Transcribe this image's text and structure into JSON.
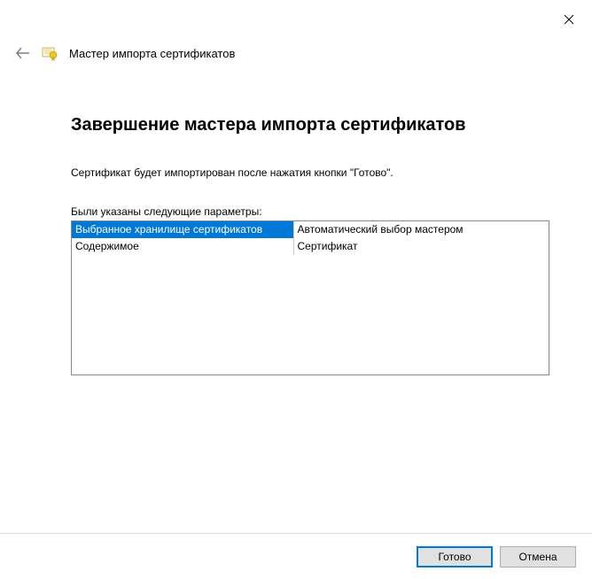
{
  "window": {
    "wizard_title": "Мастер импорта сертификатов"
  },
  "content": {
    "heading": "Завершение мастера импорта сертификатов",
    "description": "Сертификат будет импортирован после нажатия кнопки \"Готово\".",
    "params_label": "Были указаны следующие параметры:",
    "params": [
      {
        "name": "Выбранное хранилище сертификатов",
        "value": "Автоматический выбор мастером",
        "selected": true
      },
      {
        "name": "Содержимое",
        "value": "Сертификат",
        "selected": false
      }
    ]
  },
  "buttons": {
    "finish": "Готово",
    "cancel": "Отмена"
  }
}
